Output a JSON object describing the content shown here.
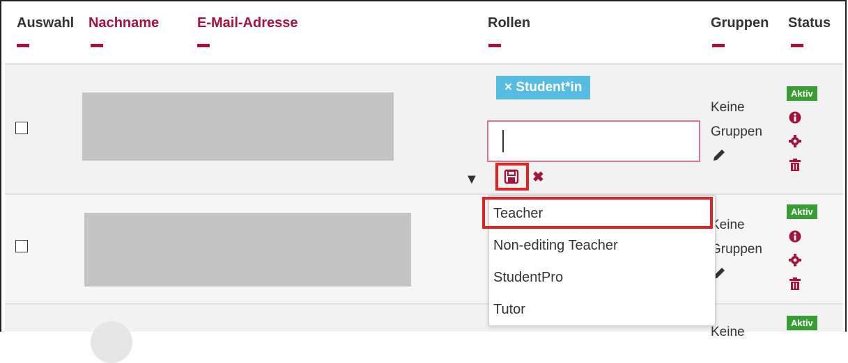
{
  "headers": {
    "auswahl": "Auswahl",
    "nachname": "Nachname",
    "email": "E-Mail-Adresse",
    "rollen": "Rollen",
    "gruppen": "Gruppen",
    "status": "Status"
  },
  "rows": [
    {
      "groups_line1": "Keine",
      "groups_line2": "Gruppen",
      "status": "Aktiv"
    },
    {
      "groups_line1": "Keine",
      "groups_line2": "Gruppen",
      "status": "Aktiv"
    },
    {
      "groups_line1": "Keine",
      "status": "Aktiv"
    }
  ],
  "role_editor": {
    "chip_remove": "×",
    "chip_label": "Student*in",
    "toggle": "▼",
    "cancel": "✖"
  },
  "dropdown_options": [
    "Teacher",
    "Non-editing Teacher",
    "StudentPro",
    "Tutor"
  ]
}
